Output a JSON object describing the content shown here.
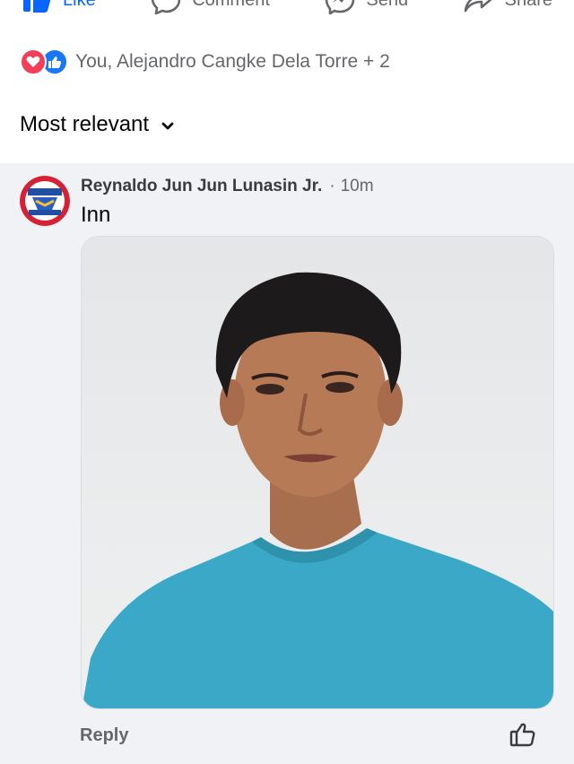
{
  "action_bar": {
    "like_label": "Like",
    "comment_label": "Comment",
    "send_label": "Send",
    "share_label": "Share",
    "liked_color": "#0866ff"
  },
  "reactions": {
    "icons": [
      "heart-icon",
      "thumbs-up-icon"
    ],
    "summary": "You, Alejandro Cangke Dela Torre + 2"
  },
  "sort": {
    "label": "Most relevant",
    "icon": "chevron-down-icon"
  },
  "comment": {
    "author": "Reynaldo Jun Jun Lunasin Jr.",
    "separator": "·",
    "time": "10m",
    "text": "Inn",
    "reply_label": "Reply",
    "like_icon": "thumbs-up-outline-icon"
  },
  "colors": {
    "background": "#ffffff",
    "comment_area": "#f0f2f5",
    "secondary_text": "#65676b",
    "love": "#f33e58",
    "like": "#1877f2"
  }
}
